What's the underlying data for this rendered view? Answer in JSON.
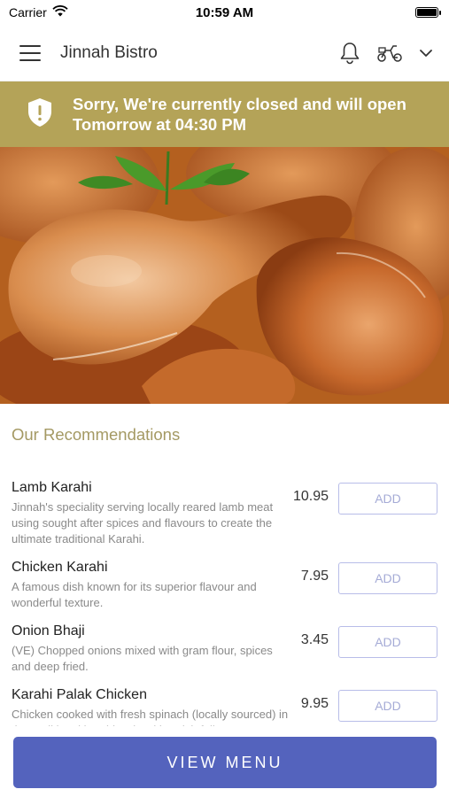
{
  "status_bar": {
    "carrier": "Carrier",
    "time": "10:59 AM"
  },
  "header": {
    "title": "Jinnah Bistro"
  },
  "banner": {
    "message": "Sorry, We're currently closed and will open Tomorrow at 04:30 PM"
  },
  "colors": {
    "banner_bg": "#b4a358",
    "accent": "#5463bd",
    "section_title": "#a49963"
  },
  "recommendations": {
    "title": "Our Recommendations",
    "items": [
      {
        "name": "Lamb Karahi",
        "description": "Jinnah's speciality serving locally reared lamb meat using sought after spices and flavours to create the ultimate traditional Karahi.",
        "price": "10.95",
        "button": "ADD"
      },
      {
        "name": "Chicken Karahi",
        "description": "A famous dish known for its superior flavour and wonderful texture.",
        "price": "7.95",
        "button": "ADD"
      },
      {
        "name": "Onion Bhaji",
        "description": "(VE) Chopped onions mixed with gram flour, spices and deep fried.",
        "price": "3.45",
        "button": "ADD"
      },
      {
        "name": "Karahi Palak Chicken",
        "description": "Chicken cooked with fresh spinach (locally sourced) in the traditional karahi style with a rich full",
        "price": "9.95",
        "button": "ADD"
      }
    ]
  },
  "footer": {
    "view_menu": "VIEW MENU"
  },
  "icons": [
    "wifi-icon",
    "battery-icon",
    "hamburger-menu-icon",
    "bell-icon",
    "scooter-icon",
    "chevron-down-icon",
    "shield-alert-icon"
  ]
}
